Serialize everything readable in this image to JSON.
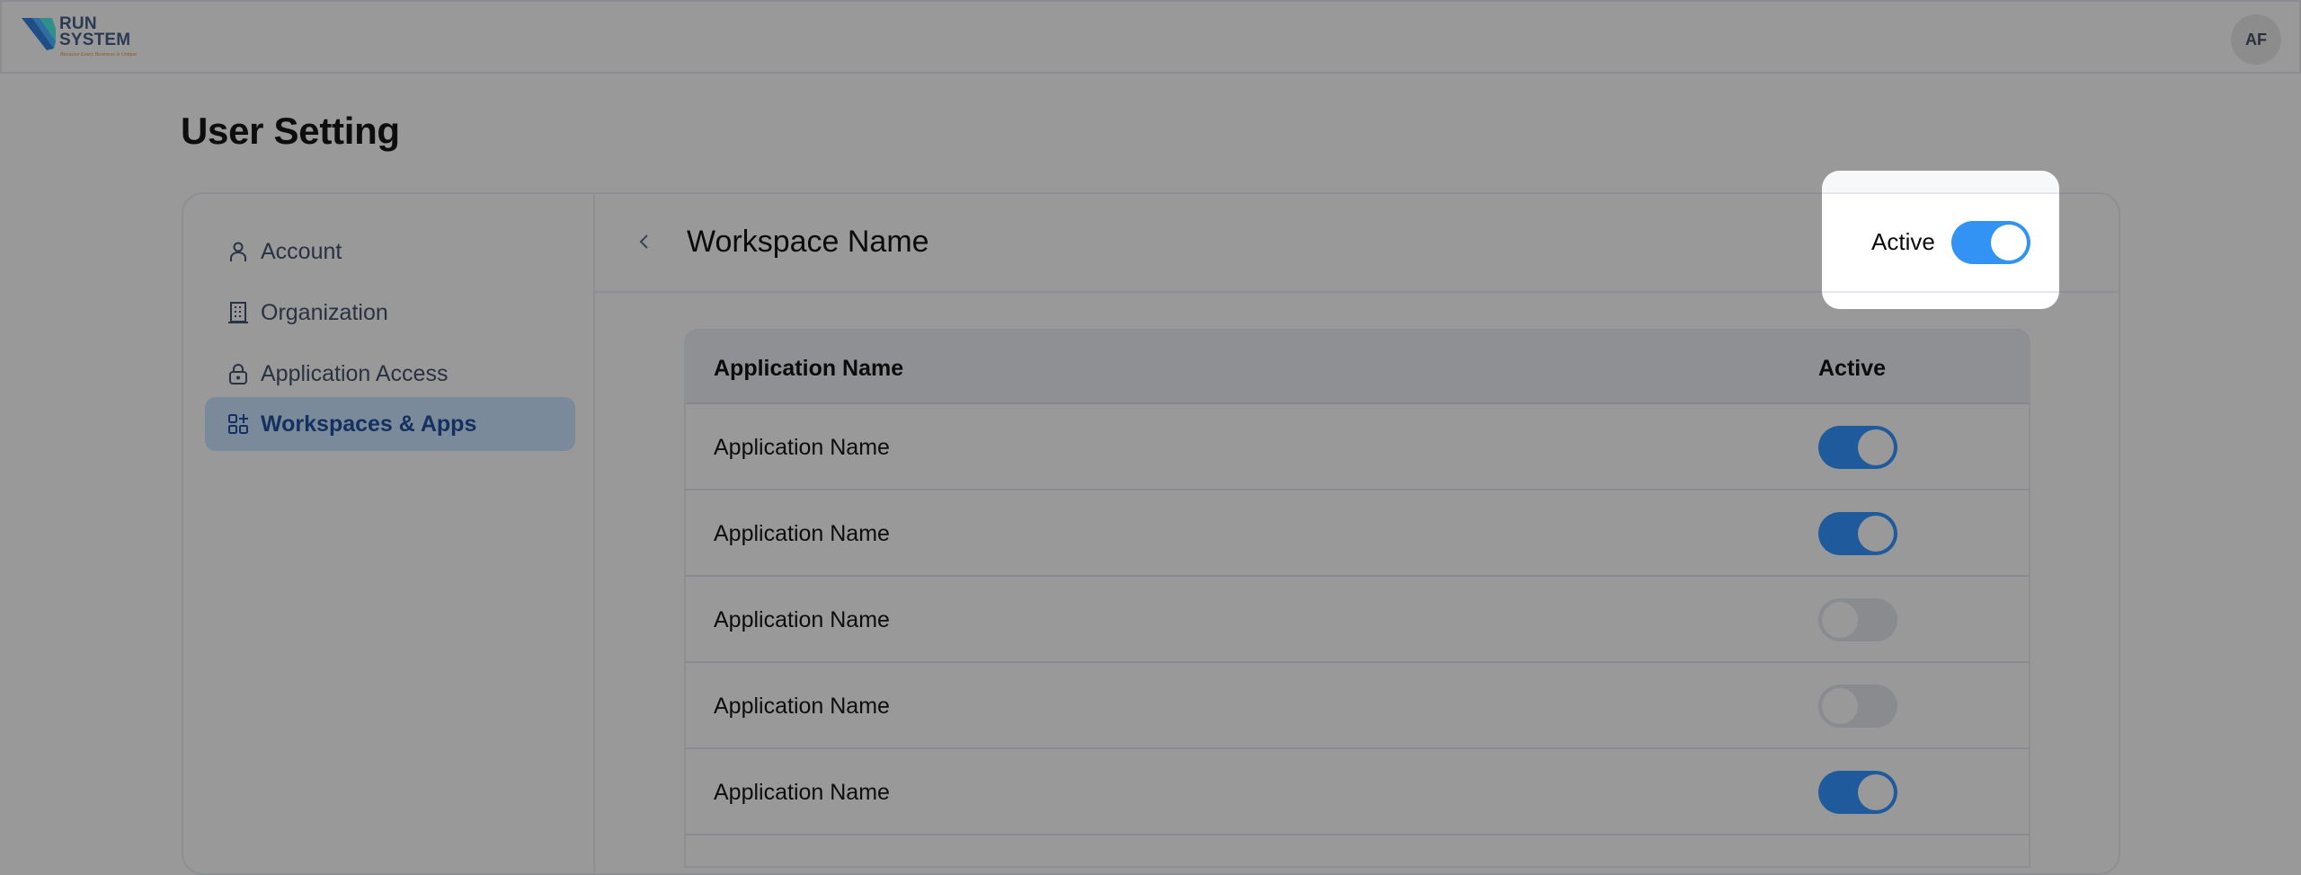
{
  "header": {
    "logo": {
      "line1": "RUN",
      "line2": "SYSTEM",
      "tagline": "Because Every Business is Unique"
    },
    "avatar_initials": "AF"
  },
  "page": {
    "title": "User Setting"
  },
  "sidebar": {
    "items": [
      {
        "label": "Account",
        "icon": "user-icon",
        "active": false
      },
      {
        "label": "Organization",
        "icon": "building-icon",
        "active": false
      },
      {
        "label": "Application Access",
        "icon": "lock-icon",
        "active": false
      },
      {
        "label": "Workspaces & Apps",
        "icon": "apps-add-icon",
        "active": true
      }
    ]
  },
  "workspace": {
    "title": "Workspace Name",
    "back_icon": "chevron-left-icon",
    "active_label": "Active",
    "active": true
  },
  "table": {
    "columns": [
      "Application Name",
      "Active"
    ],
    "rows": [
      {
        "name": "Application Name",
        "active": true
      },
      {
        "name": "Application Name",
        "active": true
      },
      {
        "name": "Application Name",
        "active": false
      },
      {
        "name": "Application Name",
        "active": false
      },
      {
        "name": "Application Name",
        "active": true
      }
    ]
  },
  "colors": {
    "overlay": "#999999",
    "toggle_on_highlight": "#3393f5",
    "toggle_on_dimmed": "#1e5a9c",
    "active_nav_text": "#14305f"
  }
}
